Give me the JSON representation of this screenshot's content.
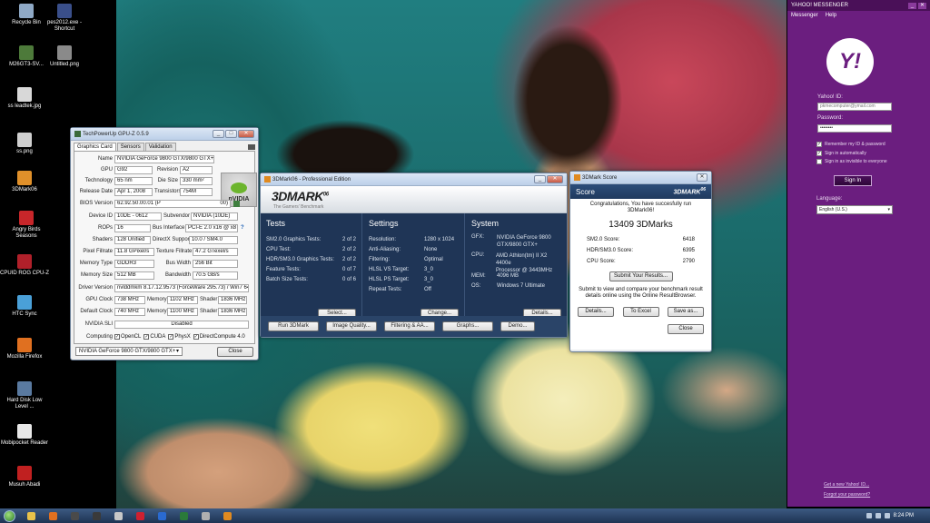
{
  "desktop": {
    "icons": [
      {
        "label": "Recycle Bin",
        "color": "#8fa9c6"
      },
      {
        "label": "pes2012.exe - Shortcut",
        "color": "#3a4f8a"
      },
      {
        "label": "M26GT3-SV...",
        "color": "#4d7a3a"
      },
      {
        "label": "Untitled.png",
        "color": "#8a8a8a"
      },
      {
        "label": "ss leadtek.jpg",
        "color": "#d8d8d8"
      },
      {
        "label": "ss.png",
        "color": "#cfcfcf"
      },
      {
        "label": "3DMark06",
        "color": "#e0902a"
      },
      {
        "label": "Angry Birds Seasons",
        "color": "#c8262a"
      },
      {
        "label": "CPUID ROG CPU-Z",
        "color": "#b0202a"
      },
      {
        "label": "HTC Sync",
        "color": "#4aa0d8"
      },
      {
        "label": "Mozilla Firefox",
        "color": "#e07020"
      },
      {
        "label": "Hard Disk Low Level ...",
        "color": "#5a7aa0"
      },
      {
        "label": "Mobipocket Reader",
        "color": "#e8e8e8"
      },
      {
        "label": "Musuh Abadi",
        "color": "#c02020"
      }
    ]
  },
  "gpuz": {
    "title": "TechPowerUp GPU-Z 0.5.9",
    "tabs": [
      "Graphics Card",
      "Sensors",
      "Validation"
    ],
    "name": {
      "label": "Name",
      "value": "NVIDIA GeForce 9800 GTX/9800 GTX+"
    },
    "gpu": {
      "label": "GPU",
      "value": "G92",
      "sub_label": "Revision",
      "sub_value": "A2"
    },
    "tech": {
      "label": "Technology",
      "value": "65 nm",
      "sub_label": "Die Size",
      "sub_value": "330 mm²"
    },
    "release": {
      "label": "Release Date",
      "value": "Apr 1, 2008",
      "sub_label": "Transistors",
      "sub_value": "754M"
    },
    "bios": {
      "label": "BIOS Version",
      "value": "62.92.50.00.01 (P",
      "tail": "00)"
    },
    "device": {
      "label": "Device ID",
      "value": "10DE - 0612",
      "sub_label": "Subvendor",
      "sub_value": "NVIDIA (10DE)"
    },
    "rops": {
      "label": "ROPs",
      "value": "16",
      "sub_label": "Bus Interface",
      "sub_value": "PCI-E 2.0 x16 @ x8 2.0",
      "help": "?"
    },
    "shaders": {
      "label": "Shaders",
      "value": "128 Unified",
      "sub_label": "DirectX Support",
      "sub_value": "10.0 / SM4.0"
    },
    "pixel": {
      "label": "Pixel Fillrate",
      "value": "11.8 GPixel/s",
      "sub_label": "Texture Fillrate",
      "sub_value": "47.2 GTexel/s"
    },
    "memtype": {
      "label": "Memory Type",
      "value": "GDDR3",
      "sub_label": "Bus Width",
      "sub_value": "256 Bit"
    },
    "memsize": {
      "label": "Memory Size",
      "value": "512 MB",
      "sub_label": "Bandwidth",
      "sub_value": "70.5 GB/s"
    },
    "driver": {
      "label": "Driver Version",
      "value": "nvlddmkm 8.17.12.9573 (ForceWare 295.73) / Win7 64"
    },
    "gpuclock": {
      "label": "GPU Clock",
      "value": "738 MHz",
      "mem_label": "Memory",
      "mem_value": "1102 MHz",
      "sh_label": "Shader",
      "sh_value": "1836 MHz"
    },
    "defclock": {
      "label": "Default Clock",
      "value": "740 MHz",
      "mem_label": "Memory",
      "mem_value": "1100 MHz",
      "sh_label": "Shader",
      "sh_value": "1836 MHz"
    },
    "sli": {
      "label": "NVIDIA SLI",
      "value": "Disabled"
    },
    "computing": {
      "label": "Computing",
      "items": [
        "OpenCL",
        "CUDA",
        "PhysX",
        "DirectCompute 4.0"
      ]
    },
    "selector": "NVIDIA GeForce 9800 GTX/9800 GTX+",
    "close": "Close",
    "logo": "nVIDIA"
  },
  "tdm": {
    "title": "3DMark06 - Professional Edition",
    "logo": "3DMARK",
    "logo_sup": "06",
    "tagline": "The Gamers' Benchmark",
    "tests": {
      "heading": "Tests",
      "rows": [
        {
          "k": "SM2.0 Graphics Tests:",
          "v": "2 of 2"
        },
        {
          "k": "CPU Test:",
          "v": "2 of 2"
        },
        {
          "k": "HDR/SM3.0 Graphics Tests:",
          "v": "2 of 2"
        },
        {
          "k": "Feature Tests:",
          "v": "0 of 7"
        },
        {
          "k": "Batch Size Tests:",
          "v": "0 of 6"
        }
      ],
      "button": "Select..."
    },
    "settings": {
      "heading": "Settings",
      "rows": [
        {
          "k": "Resolution:",
          "v": "1280 x 1024"
        },
        {
          "k": "Anti-Aliasing:",
          "v": "None"
        },
        {
          "k": "Filtering:",
          "v": "Optimal"
        },
        {
          "k": "HLSL VS Target:",
          "v": "3_0"
        },
        {
          "k": "HLSL PS Target:",
          "v": "3_0"
        },
        {
          "k": "Repeat Tests:",
          "v": "Off"
        }
      ],
      "button": "Change..."
    },
    "system": {
      "heading": "System",
      "gfx_k": "GFX:",
      "gfx_v1": "NVIDIA GeForce 9800",
      "gfx_v2": "GTX/9800 GTX+",
      "cpu_k": "CPU:",
      "cpu_v1": "AMD Athlon(tm) II X2 4400e",
      "cpu_v2": "Processor @ 3443MHz",
      "mem_k": "MEM:",
      "mem_v": "4096 MB",
      "os_k": "OS:",
      "os_v": "Windows 7 Ultimate",
      "button": "Details..."
    },
    "toolbar": [
      "Run 3DMark",
      "Image Quality...",
      "Filtering & AA...",
      "Graphs...",
      "Demo..."
    ]
  },
  "score": {
    "title": "3DMark Score",
    "header": "Score",
    "logo": "3DMARK",
    "logo_sup": "06",
    "congrats": "Congratulations, You have succesfully run 3DMark06!",
    "big": "13409 3DMarks",
    "rows": [
      {
        "k": "SM2.0 Score:",
        "v": "6418"
      },
      {
        "k": "HDR/SM3.0 Score:",
        "v": "6395"
      },
      {
        "k": "CPU Score:",
        "v": "2790"
      }
    ],
    "submit": "Submit Your Results...",
    "note": "Submit to view and compare your benchmark result details online using the Online ResultBrowser.",
    "buttons": [
      "Details...",
      "To Excel",
      "Save as..."
    ],
    "close": "Close"
  },
  "yahoo": {
    "title": "YAHOO! MESSENGER",
    "menu": [
      "Messenger",
      "Help"
    ],
    "logo": "Y!",
    "id_label": "Yahoo! ID:",
    "id_value": "pkmecomputer@ymail.com",
    "pw_label": "Password:",
    "pw_value": "••••••••",
    "remember": "Remember my ID & password",
    "auto": "Sign in automatically",
    "invisible": "Sign in as invisible to everyone",
    "signin": "Sign In",
    "lang_label": "Language:",
    "lang_value": "English (U.S.)",
    "link_new": "Get a new Yahoo! ID...",
    "link_forgot": "Forgot your password?"
  },
  "taskbar": {
    "apps": [
      {
        "name": "explorer",
        "color": "#e8c24a"
      },
      {
        "name": "firefox",
        "color": "#e07020"
      },
      {
        "name": "app3",
        "color": "#4a4a4a"
      },
      {
        "name": "app4",
        "color": "#3a3a3a"
      },
      {
        "name": "app5",
        "color": "#c8c8c8"
      },
      {
        "name": "app6",
        "color": "#d02030"
      },
      {
        "name": "app7",
        "color": "#2a6ad0"
      },
      {
        "name": "app8",
        "color": "#2a7a3a"
      },
      {
        "name": "app9",
        "color": "#b0b0b0"
      },
      {
        "name": "app10",
        "color": "#e08a20"
      }
    ],
    "clock": "8:24 PM"
  }
}
